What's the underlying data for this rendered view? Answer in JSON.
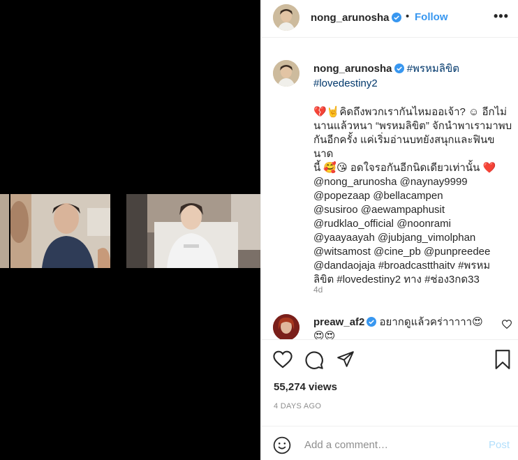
{
  "colors": {
    "link": "#00376b",
    "follow": "#3897f0",
    "muted": "#8e8e8e",
    "post_disabled": "#b2dffc",
    "verified": "#3897f0"
  },
  "header": {
    "username": "nong_arunosha",
    "dot": "•",
    "follow_label": "Follow",
    "more_label": "•••"
  },
  "caption": {
    "username": "nong_arunosha",
    "hashtags_line": [
      "#พรหมลิขิต",
      "#lovedestiny2"
    ],
    "body_lines": [
      "💔🤘คิดถึงพวกเรากันไหมออเจ้า? ☺ อีกไม่",
      "นานแล้วหนา “พรหมลิขิต” จักนำพาเรามาพบ",
      "กันอีกครั้ง แค่เริ่มอ่านบทยังสนุกและฟินขนาด",
      "นี้ 🥰😘 อดใจรอกันอีกนิดเดียวเท่านั้น ❤️"
    ],
    "mentions": [
      [
        "@nong_arunosha",
        "@naynay9999"
      ],
      [
        "@popezaap",
        "@bellacampen"
      ],
      [
        "@susiroo",
        "@aewampaphusit"
      ],
      [
        "@rudklao_official",
        "@noonrami"
      ],
      [
        "@yaayaayah",
        "@jubjang_vimolphan"
      ],
      [
        "@witsamost",
        "@cine_pb",
        "@punpreedee"
      ],
      [
        "@dandaojaja",
        "#broadcastthaitv",
        "#พรหม"
      ]
    ],
    "last_line": {
      "a": "ลิขิต",
      "b": "#lovedestiny2",
      "c": "ทาง",
      "d": "#ช่อง3กด33"
    },
    "time": "4d"
  },
  "reply": {
    "username": "preaw_af2",
    "text": "อยากดูแล้วคร่าาาาา😍",
    "text2": "😍😍"
  },
  "stats": {
    "views": "55,274 views",
    "date": "4 DAYS AGO"
  },
  "add_comment": {
    "placeholder": "Add a comment…",
    "post_label": "Post"
  },
  "icons": {
    "verified": "verified-badge-icon",
    "like": "heart-icon",
    "comment": "comment-bubble-icon",
    "share": "paper-plane-icon",
    "save": "bookmark-icon",
    "emoji": "smiley-icon"
  }
}
